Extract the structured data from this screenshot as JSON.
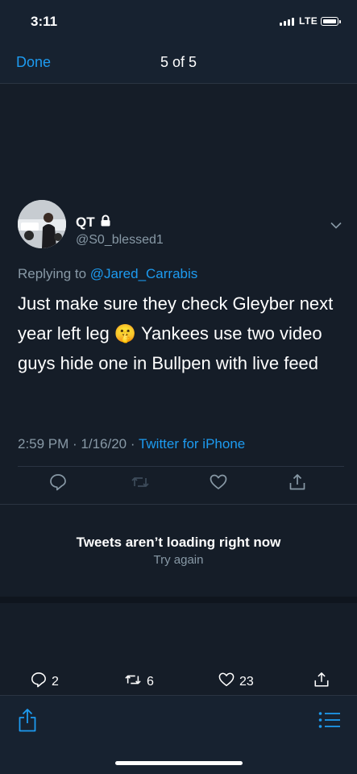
{
  "status_bar": {
    "time": "3:11",
    "network": "LTE"
  },
  "nav": {
    "done_label": "Done",
    "title": "5 of 5"
  },
  "tweet": {
    "display_name": "QT",
    "handle": "@S0_blessed1",
    "replying_prefix": "Replying to",
    "replying_to": "@Jared_Carrabis",
    "text": "Just make sure they check Gleyber next year left leg 🤫 Yankees use two video guys hide one in Bullpen with live feed",
    "time_date": "2:59 PM · 1/16/20 ·",
    "source": "Twitter for iPhone"
  },
  "icons": {
    "lock": "lock-icon",
    "chevron": "chevron-down-icon",
    "reply": "reply-icon",
    "retweet": "retweet-icon",
    "like": "heart-icon",
    "share": "share-icon",
    "list": "list-icon"
  },
  "error": {
    "title": "Tweets aren’t loading right now",
    "retry": "Try again"
  },
  "counts": {
    "replies": "2",
    "retweets": "6",
    "likes": "23"
  },
  "colors": {
    "background": "#151d28",
    "accent": "#1d9bf0",
    "muted": "#8899a6"
  }
}
